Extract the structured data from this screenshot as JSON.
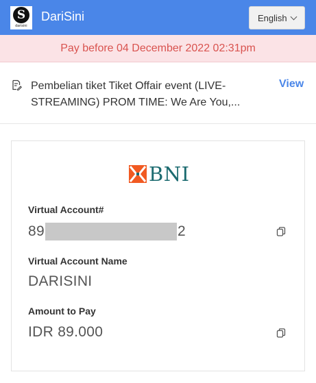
{
  "header": {
    "logo_text": "darisini",
    "logo_glyph": "S",
    "app_title": "DariSini",
    "language_label": "English",
    "background": "#4a86e8"
  },
  "deadline": {
    "text": "Pay before 04 December 2022 02:31pm",
    "color": "#d9534f"
  },
  "order": {
    "description": "Pembelian tiket Tiket Offair event (LIVE-STREAMING) PROM TIME: We Are You,...",
    "view_label": "View"
  },
  "payment": {
    "bank_name": "BNI",
    "virtual_account": {
      "label": "Virtual Account#",
      "prefix": "89",
      "suffix": "2"
    },
    "account_name": {
      "label": "Virtual Account Name",
      "value": "DARISINI"
    },
    "amount": {
      "label": "Amount to Pay",
      "value": "IDR 89.000"
    }
  }
}
